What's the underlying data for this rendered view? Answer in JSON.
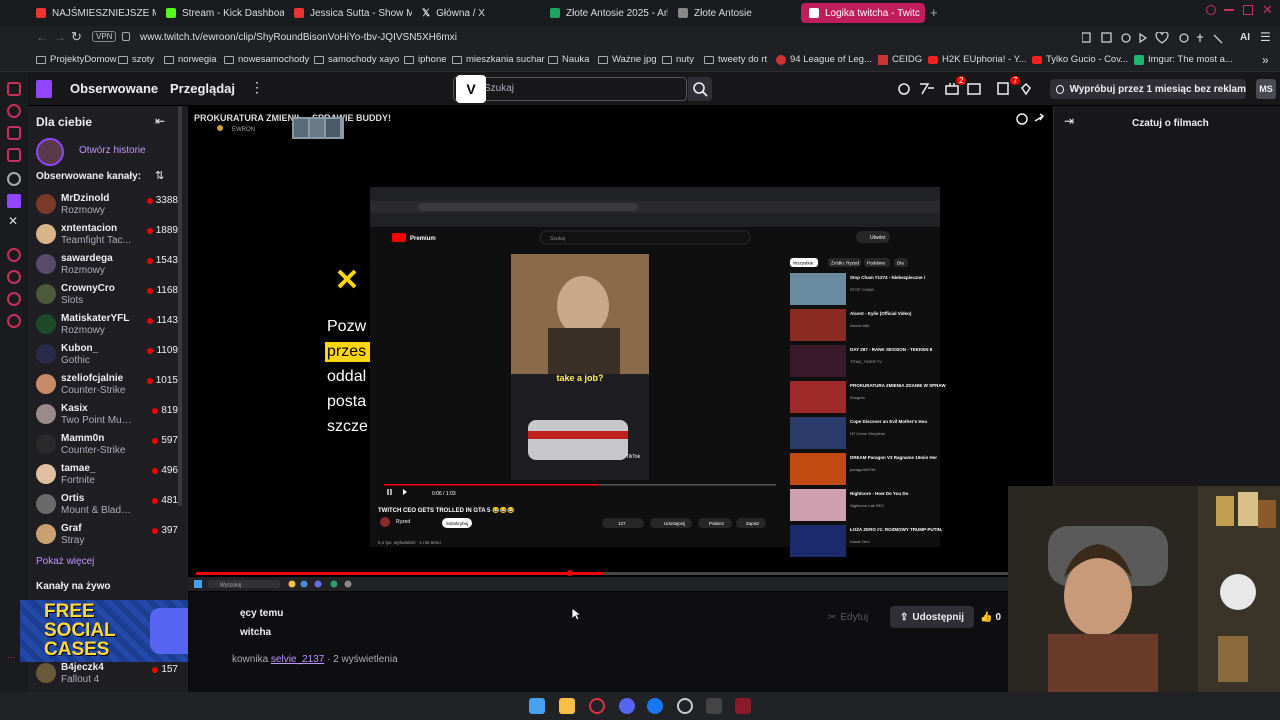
{
  "browser": {
    "tabs": [
      {
        "label": "NAJŚMIESZNIEJSZE MOM",
        "color": "#e33"
      },
      {
        "label": "Stream - Kick Dashboard",
        "color": "#53fc18"
      },
      {
        "label": "Jessica Sutta - Show Me",
        "color": "#e33"
      },
      {
        "label": "Główna / X",
        "color": "#ffffff"
      },
      {
        "label": "Złote Antosie 2025 - Arku",
        "color": "#1fa463"
      },
      {
        "label": "Złote Antosie",
        "color": "#cccccc"
      },
      {
        "label": "Logika twitcha - Twitc",
        "color": "#fff"
      }
    ],
    "vpn_label": "VPN",
    "url": "www.twitch.tv/ewroon/clip/ShyRoundBisonVoHiYo-tbv-JQIVSN5XH6mxi",
    "ai_label": "AI",
    "bookmarks": [
      "ProjektyDomow",
      "szoty",
      "norwegia",
      "nowesamochody",
      "samochody xayo",
      "iphone",
      "mieszkania suchar",
      "Nauka",
      "Ważne jpg",
      "nuty",
      "tweety do rt",
      "94 League of Leg...",
      "CEIDG",
      "H2K EUphoria! - Y...",
      "Tylko Gucio - Cov...",
      "Imgur: The most a..."
    ]
  },
  "twitch": {
    "nav": {
      "following": "Obserwowane",
      "browse": "Przeglądaj",
      "search_placeholder": "Szukaj",
      "notif_count": "2",
      "inbox_count": "7",
      "prime_label": "Wypróbuj przez 1 miesiąc bez reklam",
      "avatar_initials": "MS"
    },
    "sidebar": {
      "title": "Dla ciebie",
      "open_stories": "Otwórz historie",
      "followed_header": "Obserwowane kanały:",
      "channels": [
        {
          "name": "MrDzinold",
          "game": "Rozmowy",
          "viewers": "3388",
          "color": "#7a3a2a"
        },
        {
          "name": "xntentacion",
          "game": "Teamfight Tac...",
          "viewers": "1889",
          "color": "#d9b48a"
        },
        {
          "name": "sawardega",
          "game": "Rozmowy",
          "viewers": "1543",
          "color": "#5a4a6a"
        },
        {
          "name": "CrownyCro",
          "game": "Slots",
          "viewers": "1168",
          "color": "#4a5a3a"
        },
        {
          "name": "MatiskaterYFL",
          "game": "Rozmowy",
          "viewers": "1143",
          "color": "#1e4a2a"
        },
        {
          "name": "Kubon_",
          "game": "Gothic",
          "viewers": "1109",
          "color": "#2a2a4a"
        },
        {
          "name": "szeliofcjalnie",
          "game": "Counter-Strike",
          "viewers": "1015",
          "color": "#c98a6a"
        },
        {
          "name": "Kasix",
          "game": "Two Point Mus...",
          "viewers": "819",
          "color": "#9a8a8a"
        },
        {
          "name": "Mamm0n",
          "game": "Counter-Strike",
          "viewers": "597",
          "color": "#2a2a2a"
        },
        {
          "name": "tamae_",
          "game": "Fortnite",
          "viewers": "496",
          "color": "#e0c0a0"
        },
        {
          "name": "Ortis",
          "game": "Mount & Blade ...",
          "viewers": "481",
          "color": "#6a6a6a"
        },
        {
          "name": "Graf",
          "game": "Stray",
          "viewers": "397",
          "color": "#c9a070"
        }
      ],
      "show_more": "Pokaż więcej",
      "live_header": "Kanały na żywo",
      "bottom_channel": {
        "name": "B4jeczk4",
        "game": "Fallout 4",
        "viewers": "157"
      }
    },
    "clip": {
      "top_title": "PROKURATURA ZMIENIŁ... SPRAWIE BUDDY!",
      "channel_tag": "EWRON",
      "left_text": [
        "Pozw",
        "przes",
        "oddal",
        "posta",
        "szcze"
      ],
      "yt_title": "TWITCH CEO GETS TROLLED IN GTA 5 😂😂😂",
      "yt_channel": "Ryzed",
      "yt_subscribe": "Subskrybuj",
      "yt_meta": "6,1 tys. wyświetleń · 1 rok temu",
      "yt_likes": "127",
      "yt_share": "Udostępnij",
      "yt_download": "Pobierz",
      "yt_save": "Zapisz",
      "yt_chips": [
        "Wszystkie",
        "Źródło: Ryzed",
        "Podobne",
        "Dla"
      ],
      "yt_time": "0:06 / 1:03",
      "caption": "take a job?",
      "tiktok_label": "TikTok",
      "yt_search_placeholder": "Szukaj",
      "yt_create": "Utwórz",
      "related": [
        {
          "title": "Stop Cham #1274 - Niebezpieczne i chamskie...",
          "meta": "STOP CHAM",
          "color": "#6a8aa0"
        },
        {
          "title": "Alcent - Kylie (Official Video)",
          "meta": "Alcent Miki",
          "color": "#8a2a20"
        },
        {
          "title": "DAY 287 - RANK SESSION - TEKKEN 8 Rank Match LIVE!...",
          "meta": "TITAN_TIGER TV",
          "color": "#3a1a2a"
        },
        {
          "title": "PROKURATURA ZMIENIA ZDANIE W SPRAWIE BUDDY!",
          "meta": "Kongres",
          "color": "#a02a2a"
        },
        {
          "title": "Cope Discover an Evil Mother's House Of Horrors",
          "meta": "NT Crime Storytime",
          "color": "#2a3a6a"
        },
        {
          "title": "DREAM Paragon V3 Ragname 15min Heroic",
          "meta": "paragonWOW",
          "color": "#c04a10"
        },
        {
          "title": "Nightcore - How Do You Do",
          "meta": "Nightcore Lab REC",
          "color": "#d0a0b0"
        },
        {
          "title": "ŁOŻA ZERO #1: ROZMOWY TRUMP-PUTIN, KAMPANIA...",
          "meta": "Kanał Zero",
          "color": "#1a2a6a"
        }
      ],
      "progress": 0.55
    },
    "chat_header": "Czatuj o filmach",
    "below": {
      "ago": "ęcy temu",
      "title": "witcha",
      "clipped_by_prefix": "kownika",
      "clipped_by_user": "selvie_2137",
      "views": " · 2 wyświetlenia",
      "edit": "Edytuj",
      "share": "Udostępnij",
      "likes": "0"
    },
    "ad": {
      "line1": "FREE",
      "line2": "SOCIAL",
      "line3": "CASES"
    }
  },
  "taskbar": {
    "search_placeholder": "Wyszukaj"
  }
}
